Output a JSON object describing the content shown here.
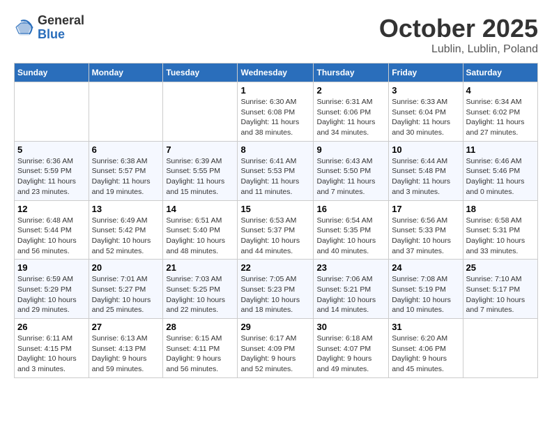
{
  "logo": {
    "general": "General",
    "blue": "Blue"
  },
  "header": {
    "month": "October 2025",
    "location": "Lublin, Lublin, Poland"
  },
  "weekdays": [
    "Sunday",
    "Monday",
    "Tuesday",
    "Wednesday",
    "Thursday",
    "Friday",
    "Saturday"
  ],
  "weeks": [
    [
      {
        "day": "",
        "info": ""
      },
      {
        "day": "",
        "info": ""
      },
      {
        "day": "",
        "info": ""
      },
      {
        "day": "1",
        "info": "Sunrise: 6:30 AM\nSunset: 6:08 PM\nDaylight: 11 hours\nand 38 minutes."
      },
      {
        "day": "2",
        "info": "Sunrise: 6:31 AM\nSunset: 6:06 PM\nDaylight: 11 hours\nand 34 minutes."
      },
      {
        "day": "3",
        "info": "Sunrise: 6:33 AM\nSunset: 6:04 PM\nDaylight: 11 hours\nand 30 minutes."
      },
      {
        "day": "4",
        "info": "Sunrise: 6:34 AM\nSunset: 6:02 PM\nDaylight: 11 hours\nand 27 minutes."
      }
    ],
    [
      {
        "day": "5",
        "info": "Sunrise: 6:36 AM\nSunset: 5:59 PM\nDaylight: 11 hours\nand 23 minutes."
      },
      {
        "day": "6",
        "info": "Sunrise: 6:38 AM\nSunset: 5:57 PM\nDaylight: 11 hours\nand 19 minutes."
      },
      {
        "day": "7",
        "info": "Sunrise: 6:39 AM\nSunset: 5:55 PM\nDaylight: 11 hours\nand 15 minutes."
      },
      {
        "day": "8",
        "info": "Sunrise: 6:41 AM\nSunset: 5:53 PM\nDaylight: 11 hours\nand 11 minutes."
      },
      {
        "day": "9",
        "info": "Sunrise: 6:43 AM\nSunset: 5:50 PM\nDaylight: 11 hours\nand 7 minutes."
      },
      {
        "day": "10",
        "info": "Sunrise: 6:44 AM\nSunset: 5:48 PM\nDaylight: 11 hours\nand 3 minutes."
      },
      {
        "day": "11",
        "info": "Sunrise: 6:46 AM\nSunset: 5:46 PM\nDaylight: 11 hours\nand 0 minutes."
      }
    ],
    [
      {
        "day": "12",
        "info": "Sunrise: 6:48 AM\nSunset: 5:44 PM\nDaylight: 10 hours\nand 56 minutes."
      },
      {
        "day": "13",
        "info": "Sunrise: 6:49 AM\nSunset: 5:42 PM\nDaylight: 10 hours\nand 52 minutes."
      },
      {
        "day": "14",
        "info": "Sunrise: 6:51 AM\nSunset: 5:40 PM\nDaylight: 10 hours\nand 48 minutes."
      },
      {
        "day": "15",
        "info": "Sunrise: 6:53 AM\nSunset: 5:37 PM\nDaylight: 10 hours\nand 44 minutes."
      },
      {
        "day": "16",
        "info": "Sunrise: 6:54 AM\nSunset: 5:35 PM\nDaylight: 10 hours\nand 40 minutes."
      },
      {
        "day": "17",
        "info": "Sunrise: 6:56 AM\nSunset: 5:33 PM\nDaylight: 10 hours\nand 37 minutes."
      },
      {
        "day": "18",
        "info": "Sunrise: 6:58 AM\nSunset: 5:31 PM\nDaylight: 10 hours\nand 33 minutes."
      }
    ],
    [
      {
        "day": "19",
        "info": "Sunrise: 6:59 AM\nSunset: 5:29 PM\nDaylight: 10 hours\nand 29 minutes."
      },
      {
        "day": "20",
        "info": "Sunrise: 7:01 AM\nSunset: 5:27 PM\nDaylight: 10 hours\nand 25 minutes."
      },
      {
        "day": "21",
        "info": "Sunrise: 7:03 AM\nSunset: 5:25 PM\nDaylight: 10 hours\nand 22 minutes."
      },
      {
        "day": "22",
        "info": "Sunrise: 7:05 AM\nSunset: 5:23 PM\nDaylight: 10 hours\nand 18 minutes."
      },
      {
        "day": "23",
        "info": "Sunrise: 7:06 AM\nSunset: 5:21 PM\nDaylight: 10 hours\nand 14 minutes."
      },
      {
        "day": "24",
        "info": "Sunrise: 7:08 AM\nSunset: 5:19 PM\nDaylight: 10 hours\nand 10 minutes."
      },
      {
        "day": "25",
        "info": "Sunrise: 7:10 AM\nSunset: 5:17 PM\nDaylight: 10 hours\nand 7 minutes."
      }
    ],
    [
      {
        "day": "26",
        "info": "Sunrise: 6:11 AM\nSunset: 4:15 PM\nDaylight: 10 hours\nand 3 minutes."
      },
      {
        "day": "27",
        "info": "Sunrise: 6:13 AM\nSunset: 4:13 PM\nDaylight: 9 hours\nand 59 minutes."
      },
      {
        "day": "28",
        "info": "Sunrise: 6:15 AM\nSunset: 4:11 PM\nDaylight: 9 hours\nand 56 minutes."
      },
      {
        "day": "29",
        "info": "Sunrise: 6:17 AM\nSunset: 4:09 PM\nDaylight: 9 hours\nand 52 minutes."
      },
      {
        "day": "30",
        "info": "Sunrise: 6:18 AM\nSunset: 4:07 PM\nDaylight: 9 hours\nand 49 minutes."
      },
      {
        "day": "31",
        "info": "Sunrise: 6:20 AM\nSunset: 4:06 PM\nDaylight: 9 hours\nand 45 minutes."
      },
      {
        "day": "",
        "info": ""
      }
    ]
  ]
}
